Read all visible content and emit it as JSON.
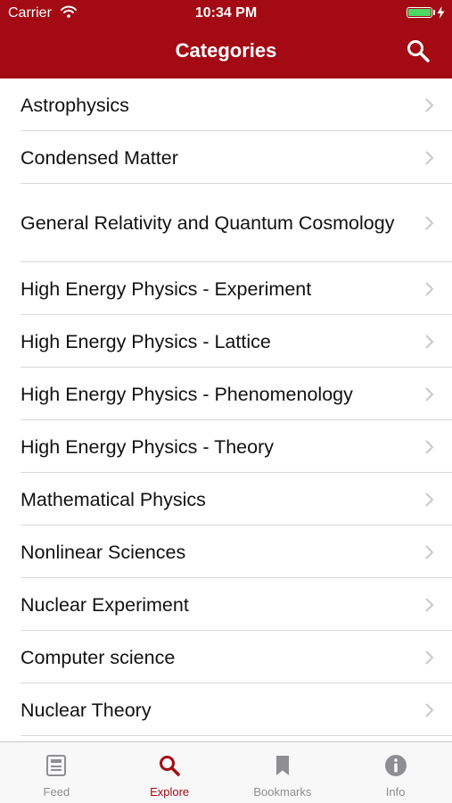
{
  "status_bar": {
    "carrier": "Carrier",
    "time": "10:34 PM",
    "battery_color": "#4cd964"
  },
  "nav": {
    "title": "Categories",
    "background_color": "#a30a13",
    "search_icon": "search-icon"
  },
  "categories": [
    {
      "label": "Astrophysics"
    },
    {
      "label": "Condensed Matter"
    },
    {
      "label": "General Relativity and Quantum Cosmology"
    },
    {
      "label": "High Energy Physics - Experiment"
    },
    {
      "label": "High Energy Physics - Lattice"
    },
    {
      "label": "High Energy Physics - Phenomenology"
    },
    {
      "label": "High Energy Physics - Theory"
    },
    {
      "label": "Mathematical Physics"
    },
    {
      "label": "Nonlinear Sciences"
    },
    {
      "label": "Nuclear Experiment"
    },
    {
      "label": "Computer science"
    },
    {
      "label": "Nuclear Theory"
    }
  ],
  "tab_bar": {
    "active_color": "#a30a13",
    "inactive_color": "#8e8e93",
    "tabs": [
      {
        "label": "Feed",
        "icon": "feed-icon"
      },
      {
        "label": "Explore",
        "icon": "search-icon",
        "active": true
      },
      {
        "label": "Bookmarks",
        "icon": "bookmark-icon"
      },
      {
        "label": "Info",
        "icon": "info-icon"
      }
    ]
  }
}
